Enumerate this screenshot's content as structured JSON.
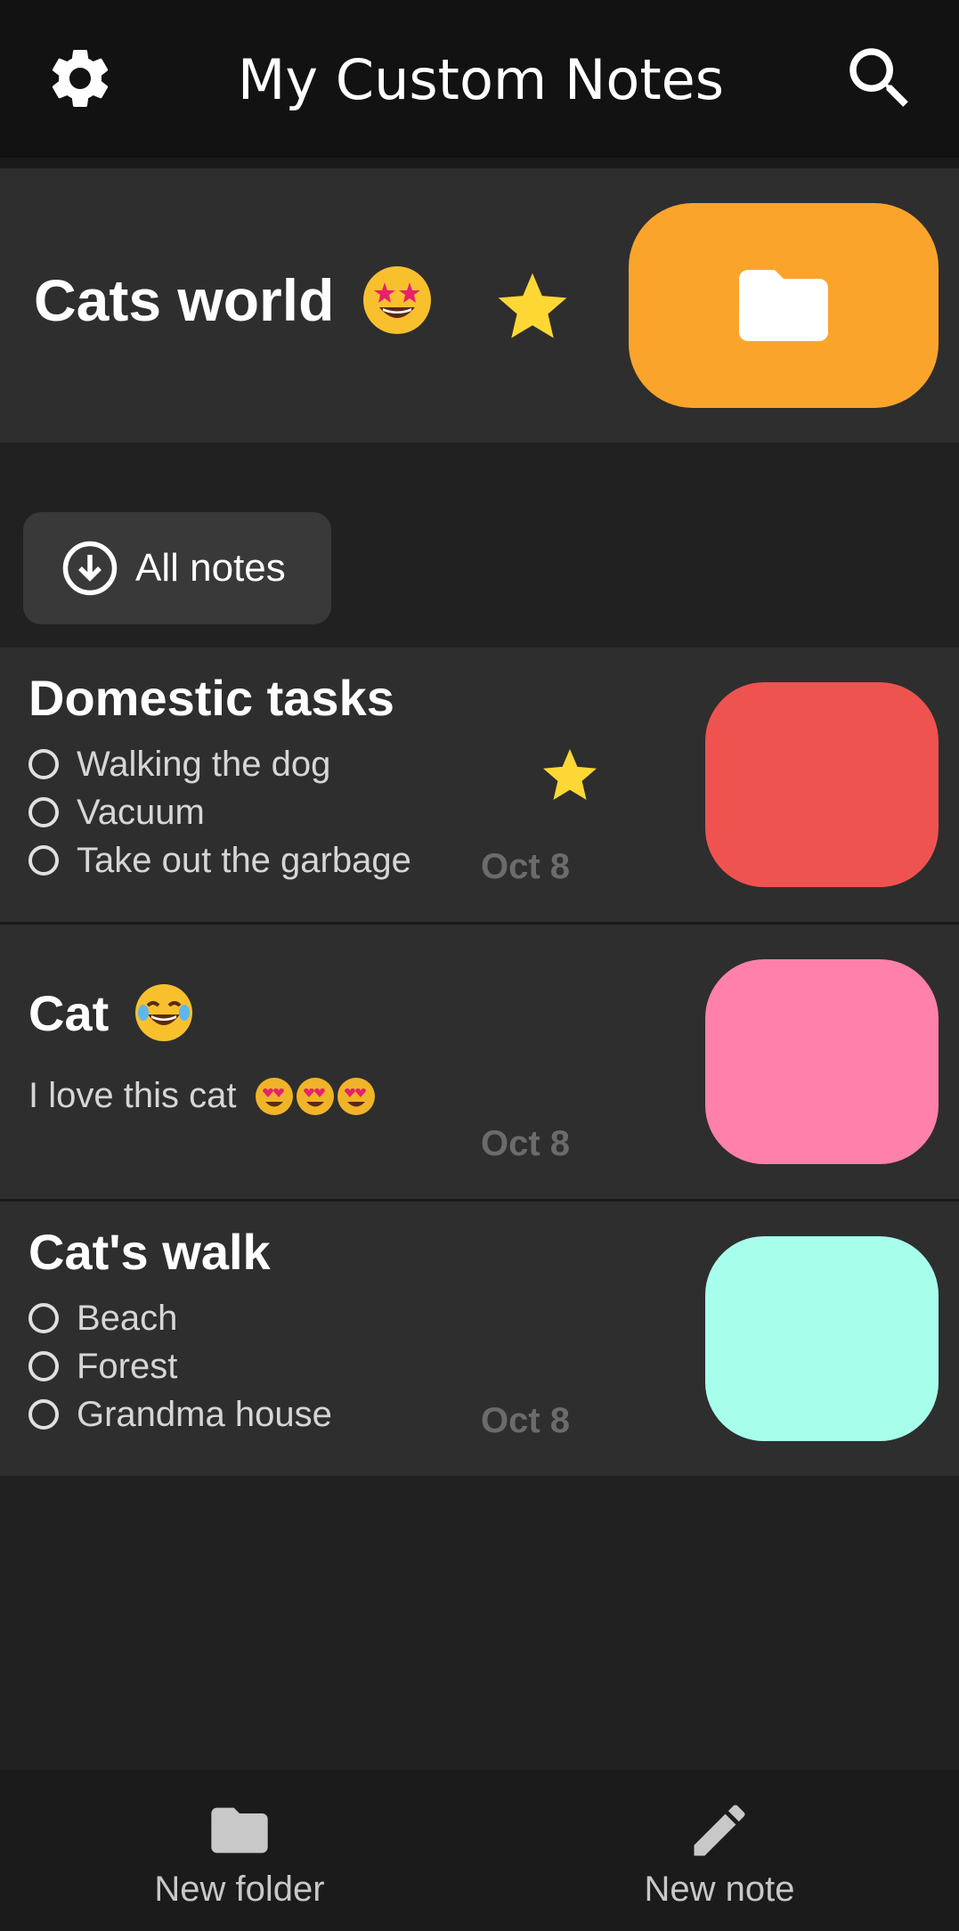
{
  "app_bar": {
    "title": "My Custom Notes",
    "settings_icon": "gear-icon",
    "search_icon": "search-icon"
  },
  "folder": {
    "name": "Cats world",
    "name_emoji": "star-struck-emoji",
    "favorite_icon": "star-icon",
    "folder_icon": "folder-icon",
    "color": "#fba42c"
  },
  "filter": {
    "label": "All notes",
    "icon": "arrow-down-circle-icon"
  },
  "notes": [
    {
      "title": "Domestic tasks",
      "type": "checklist",
      "items": [
        "Walking the dog",
        "Vacuum",
        "Take out the garbage"
      ],
      "date": "Oct 8",
      "favorite": true,
      "color": "#ef5350"
    },
    {
      "title": "Cat",
      "title_emoji": "tears-of-joy-emoji",
      "type": "text",
      "body": "I love this cat",
      "body_emojis": [
        "heart-eyes-emoji",
        "heart-eyes-emoji",
        "heart-eyes-emoji"
      ],
      "date": "Oct 8",
      "favorite": false,
      "color": "#ff80ab"
    },
    {
      "title": "Cat's walk",
      "type": "checklist",
      "items": [
        "Beach",
        "Forest",
        "Grandma house"
      ],
      "date": "Oct 8",
      "favorite": false,
      "color": "#a7ffeb"
    }
  ],
  "bottom_bar": {
    "new_folder_label": "New folder",
    "new_folder_icon": "folder-icon",
    "new_note_label": "New note",
    "new_note_icon": "pencil-icon"
  },
  "colors": {
    "background": "#212121",
    "app_bar": "#121212",
    "card": "#2e2e2e",
    "star": "#fdd835",
    "date_text": "#6b6b6b"
  }
}
